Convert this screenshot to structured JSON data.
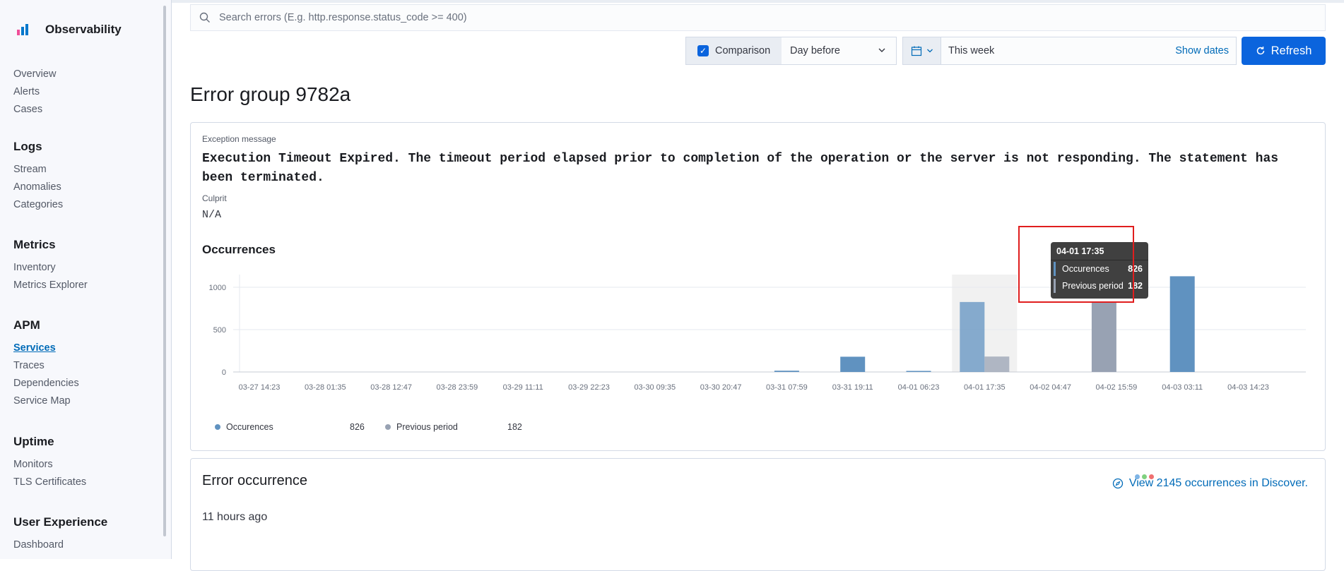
{
  "sidebar": {
    "title": "Observability",
    "sections": [
      {
        "heading": "",
        "items": [
          "Overview",
          "Alerts",
          "Cases"
        ]
      },
      {
        "heading": "Logs",
        "items": [
          "Stream",
          "Anomalies",
          "Categories"
        ]
      },
      {
        "heading": "Metrics",
        "items": [
          "Inventory",
          "Metrics Explorer"
        ]
      },
      {
        "heading": "APM",
        "items": [
          "Services",
          "Traces",
          "Dependencies",
          "Service Map"
        ]
      },
      {
        "heading": "Uptime",
        "items": [
          "Monitors",
          "TLS Certificates"
        ]
      },
      {
        "heading": "User Experience",
        "items": [
          "Dashboard"
        ]
      }
    ],
    "active_item": "Services"
  },
  "toolbar": {
    "search_placeholder": "Search errors (E.g. http.response.status_code >= 400)",
    "comparison_label": "Comparison",
    "comparison_checked": true,
    "comparison_option": "Day before",
    "date_range": "This week",
    "show_dates": "Show dates",
    "refresh": "Refresh"
  },
  "page_title": "Error group 9782a",
  "details": {
    "exception_label": "Exception message",
    "exception_message": "Execution Timeout Expired. The timeout period elapsed prior to completion of the operation or the server is not responding. The statement has been terminated.",
    "culprit_label": "Culprit",
    "culprit_value": "N/A",
    "occurrences_title": "Occurrences"
  },
  "chart_data": {
    "type": "bar",
    "x_ticks": [
      "03-27 14:23",
      "03-28 01:35",
      "03-28 12:47",
      "03-28 23:59",
      "03-29 11:11",
      "03-29 22:23",
      "03-30 09:35",
      "03-30 20:47",
      "03-31 07:59",
      "03-31 19:11",
      "04-01 06:23",
      "04-01 17:35",
      "04-02 04:47",
      "04-02 15:59",
      "04-03 03:11",
      "04-03 14:23"
    ],
    "y_ticks": [
      0,
      500,
      1000
    ],
    "ylim": [
      0,
      1150
    ],
    "series": [
      {
        "name": "Occurences",
        "color": "#6092c0",
        "values": [
          0,
          0,
          0,
          0,
          0,
          0,
          0,
          0,
          15,
          180,
          10,
          826,
          0,
          0,
          1130,
          0
        ]
      },
      {
        "name": "Previous period",
        "color": "#98a2b3",
        "values": [
          0,
          0,
          0,
          0,
          0,
          0,
          0,
          0,
          0,
          0,
          0,
          182,
          0,
          826,
          0,
          0
        ]
      }
    ],
    "highlighted_index": 11,
    "legend": [
      {
        "name": "Occurences",
        "value": "826",
        "color": "#6092c0"
      },
      {
        "name": "Previous period",
        "value": "182",
        "color": "#98a2b3"
      }
    ],
    "tooltip": {
      "title": "04-01 17:35",
      "rows": [
        {
          "name": "Occurences",
          "value": "826",
          "color": "#6092c0"
        },
        {
          "name": "Previous period",
          "value": "182",
          "color": "#98a2b3"
        }
      ]
    }
  },
  "error_occurrence": {
    "title": "Error occurrence",
    "view_link": "View 2145 occurrences in Discover.",
    "time_ago": "11 hours ago"
  }
}
